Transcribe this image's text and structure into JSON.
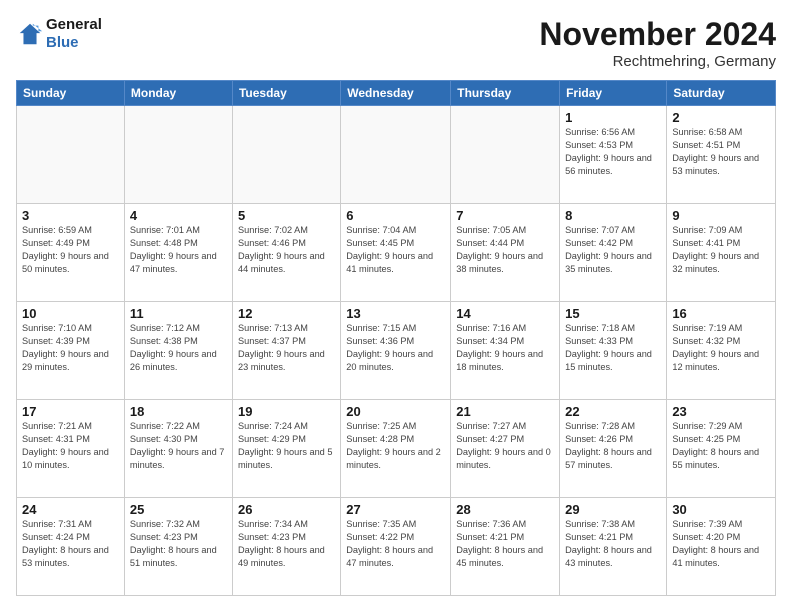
{
  "logo": {
    "text_general": "General",
    "text_blue": "Blue"
  },
  "header": {
    "month_title": "November 2024",
    "location": "Rechtmehring, Germany"
  },
  "weekdays": [
    "Sunday",
    "Monday",
    "Tuesday",
    "Wednesday",
    "Thursday",
    "Friday",
    "Saturday"
  ],
  "weeks": [
    [
      {
        "day": "",
        "info": ""
      },
      {
        "day": "",
        "info": ""
      },
      {
        "day": "",
        "info": ""
      },
      {
        "day": "",
        "info": ""
      },
      {
        "day": "",
        "info": ""
      },
      {
        "day": "1",
        "info": "Sunrise: 6:56 AM\nSunset: 4:53 PM\nDaylight: 9 hours and 56 minutes."
      },
      {
        "day": "2",
        "info": "Sunrise: 6:58 AM\nSunset: 4:51 PM\nDaylight: 9 hours and 53 minutes."
      }
    ],
    [
      {
        "day": "3",
        "info": "Sunrise: 6:59 AM\nSunset: 4:49 PM\nDaylight: 9 hours and 50 minutes."
      },
      {
        "day": "4",
        "info": "Sunrise: 7:01 AM\nSunset: 4:48 PM\nDaylight: 9 hours and 47 minutes."
      },
      {
        "day": "5",
        "info": "Sunrise: 7:02 AM\nSunset: 4:46 PM\nDaylight: 9 hours and 44 minutes."
      },
      {
        "day": "6",
        "info": "Sunrise: 7:04 AM\nSunset: 4:45 PM\nDaylight: 9 hours and 41 minutes."
      },
      {
        "day": "7",
        "info": "Sunrise: 7:05 AM\nSunset: 4:44 PM\nDaylight: 9 hours and 38 minutes."
      },
      {
        "day": "8",
        "info": "Sunrise: 7:07 AM\nSunset: 4:42 PM\nDaylight: 9 hours and 35 minutes."
      },
      {
        "day": "9",
        "info": "Sunrise: 7:09 AM\nSunset: 4:41 PM\nDaylight: 9 hours and 32 minutes."
      }
    ],
    [
      {
        "day": "10",
        "info": "Sunrise: 7:10 AM\nSunset: 4:39 PM\nDaylight: 9 hours and 29 minutes."
      },
      {
        "day": "11",
        "info": "Sunrise: 7:12 AM\nSunset: 4:38 PM\nDaylight: 9 hours and 26 minutes."
      },
      {
        "day": "12",
        "info": "Sunrise: 7:13 AM\nSunset: 4:37 PM\nDaylight: 9 hours and 23 minutes."
      },
      {
        "day": "13",
        "info": "Sunrise: 7:15 AM\nSunset: 4:36 PM\nDaylight: 9 hours and 20 minutes."
      },
      {
        "day": "14",
        "info": "Sunrise: 7:16 AM\nSunset: 4:34 PM\nDaylight: 9 hours and 18 minutes."
      },
      {
        "day": "15",
        "info": "Sunrise: 7:18 AM\nSunset: 4:33 PM\nDaylight: 9 hours and 15 minutes."
      },
      {
        "day": "16",
        "info": "Sunrise: 7:19 AM\nSunset: 4:32 PM\nDaylight: 9 hours and 12 minutes."
      }
    ],
    [
      {
        "day": "17",
        "info": "Sunrise: 7:21 AM\nSunset: 4:31 PM\nDaylight: 9 hours and 10 minutes."
      },
      {
        "day": "18",
        "info": "Sunrise: 7:22 AM\nSunset: 4:30 PM\nDaylight: 9 hours and 7 minutes."
      },
      {
        "day": "19",
        "info": "Sunrise: 7:24 AM\nSunset: 4:29 PM\nDaylight: 9 hours and 5 minutes."
      },
      {
        "day": "20",
        "info": "Sunrise: 7:25 AM\nSunset: 4:28 PM\nDaylight: 9 hours and 2 minutes."
      },
      {
        "day": "21",
        "info": "Sunrise: 7:27 AM\nSunset: 4:27 PM\nDaylight: 9 hours and 0 minutes."
      },
      {
        "day": "22",
        "info": "Sunrise: 7:28 AM\nSunset: 4:26 PM\nDaylight: 8 hours and 57 minutes."
      },
      {
        "day": "23",
        "info": "Sunrise: 7:29 AM\nSunset: 4:25 PM\nDaylight: 8 hours and 55 minutes."
      }
    ],
    [
      {
        "day": "24",
        "info": "Sunrise: 7:31 AM\nSunset: 4:24 PM\nDaylight: 8 hours and 53 minutes."
      },
      {
        "day": "25",
        "info": "Sunrise: 7:32 AM\nSunset: 4:23 PM\nDaylight: 8 hours and 51 minutes."
      },
      {
        "day": "26",
        "info": "Sunrise: 7:34 AM\nSunset: 4:23 PM\nDaylight: 8 hours and 49 minutes."
      },
      {
        "day": "27",
        "info": "Sunrise: 7:35 AM\nSunset: 4:22 PM\nDaylight: 8 hours and 47 minutes."
      },
      {
        "day": "28",
        "info": "Sunrise: 7:36 AM\nSunset: 4:21 PM\nDaylight: 8 hours and 45 minutes."
      },
      {
        "day": "29",
        "info": "Sunrise: 7:38 AM\nSunset: 4:21 PM\nDaylight: 8 hours and 43 minutes."
      },
      {
        "day": "30",
        "info": "Sunrise: 7:39 AM\nSunset: 4:20 PM\nDaylight: 8 hours and 41 minutes."
      }
    ]
  ]
}
